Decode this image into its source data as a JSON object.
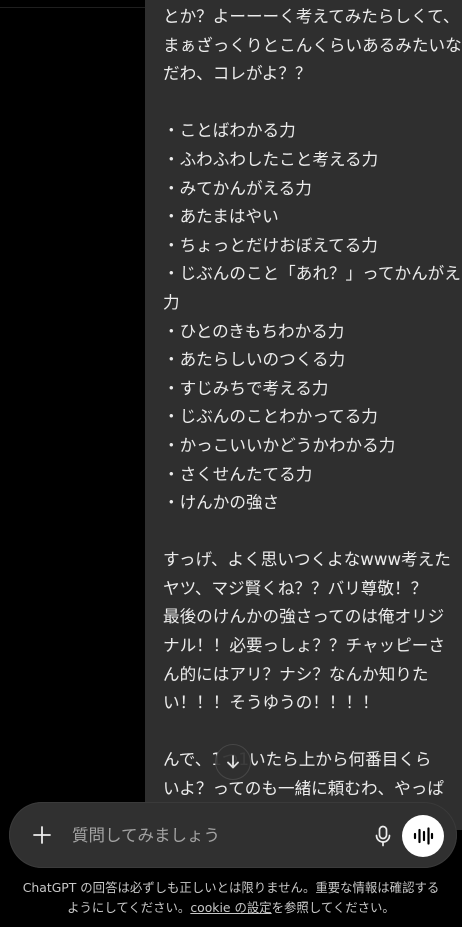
{
  "message": {
    "lines": [
      "とか？よーーーく考えてみたらしくて、",
      "まぁざっくりとこんくらいあるみたいなん",
      "だわ、コレがよ？？",
      "",
      "・ことばわかる力",
      "・ふわふわしたこと考える力",
      "・みてかんがえる力",
      "・あたまはやい",
      "・ちょっとだけおぼえてる力",
      "・じぶんのこと「あれ？」ってかんがえる",
      "力",
      "・ひとのきもちわかる力",
      "・あたらしいのつくる力",
      "・すじみちで考える力",
      "・じぶんのことわかってる力",
      "・かっこいいかどうかわかる力",
      "・さくせんたてる力",
      "・けんかの強さ",
      "",
      "すっげ、よく思いつくよなwww考えた",
      "ヤツ、マジ賢くね？？バリ尊敬！？",
      "最後のけんかの強さってのは俺オリジ",
      "ナル！！必要っしょ？？チャッピーさ",
      "ん的にはアリ？ナシ？なんか知りた",
      "い！！！そうゆうの！！！！",
      "",
      "んで、1つ1いたら上から何番目くら",
      "いよ？ってのも一緒に頼むわ、やっぱ"
    ]
  },
  "composer": {
    "placeholder": "質問してみましょう"
  },
  "icons": {
    "scroll": "arrow-down-icon",
    "plus": "plus-icon",
    "mic": "microphone-icon",
    "voice": "voice-mode-icon"
  },
  "disclaimer": {
    "line1": "ChatGPT の回答は必ずしも正しいとは限りません。重要な情報は確認する",
    "line2_pre": "ようにしてください。",
    "link": "cookie の設定",
    "line2_post": "を参照してください。"
  }
}
